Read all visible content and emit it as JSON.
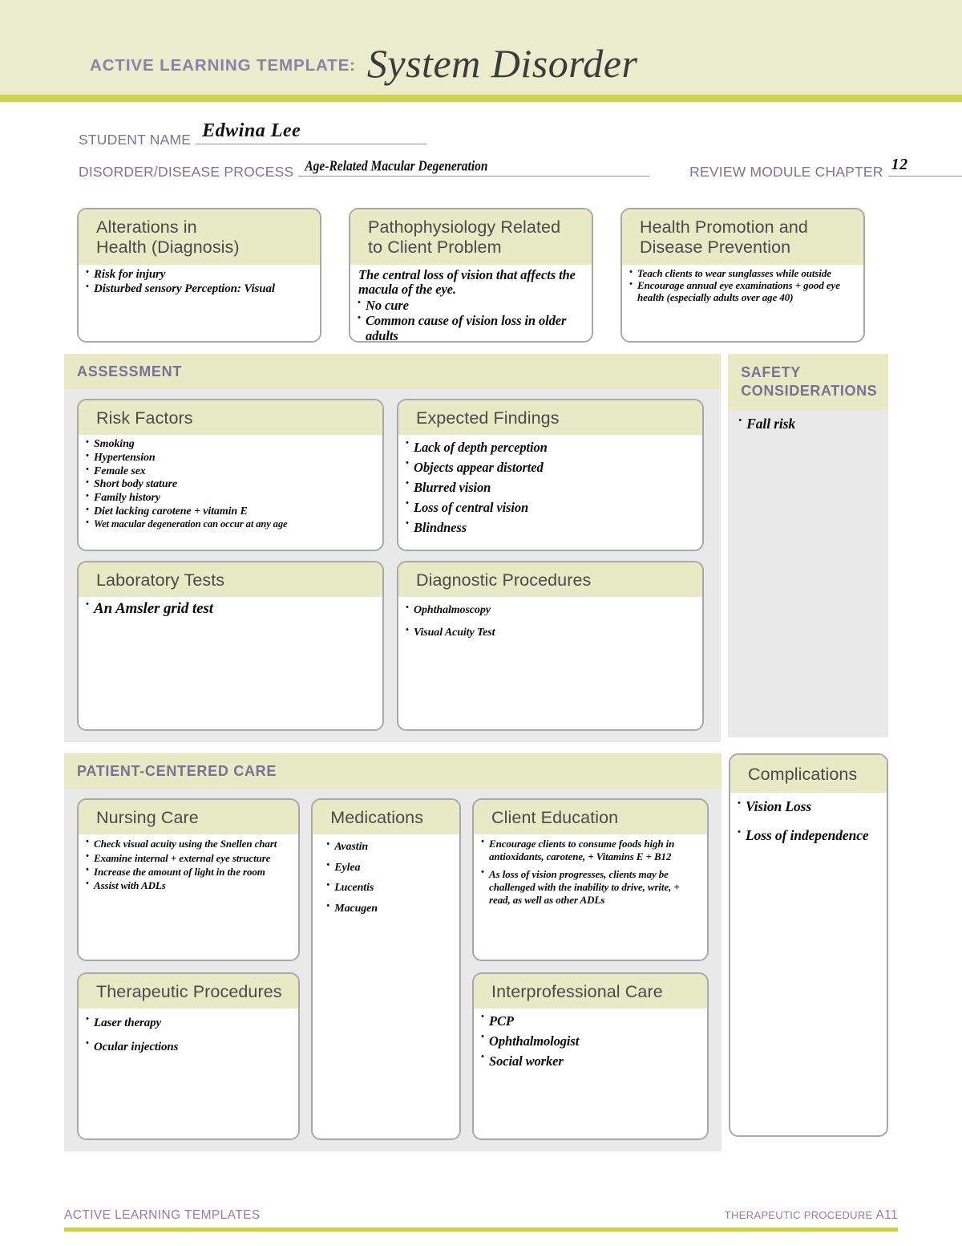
{
  "header": {
    "eyebrow": "ACTIVE LEARNING TEMPLATE:",
    "title": "System Disorder",
    "band_color": "#ebecce",
    "rule_color": "#ccd152"
  },
  "fields": {
    "student_name_label": "STUDENT NAME",
    "student_name_value": "Edwina  Lee",
    "disorder_label": "DISORDER/DISEASE PROCESS",
    "disorder_value": "Age-Related Macular Degeneration",
    "chapter_label": "REVIEW MODULE CHAPTER",
    "chapter_value": "12"
  },
  "top_boxes": [
    {
      "title": "Alterations in\nHealth (Diagnosis)",
      "items": [
        "Risk for injury",
        "Disturbed sensory Perception: Visual"
      ]
    },
    {
      "title": "Pathophysiology Related\nto Client Problem",
      "lead": "The central loss of vision that affects the macula of the eye.",
      "items": [
        "No cure",
        "Common cause of vision loss in older adults"
      ]
    },
    {
      "title": "Health Promotion and\nDisease Prevention",
      "items": [
        "Teach clients to wear sunglasses while outside",
        "Encourage annual eye examinations + good eye health (especially adults over age 40)"
      ]
    }
  ],
  "assessment": {
    "section_title": "ASSESSMENT",
    "risk_factors": {
      "title": "Risk Factors",
      "items": [
        "Smoking",
        "Hypertension",
        "Female sex",
        "Short body stature",
        "Family history",
        "Diet lacking carotene + vitamin E",
        "Wet macular degeneration can occur at any age"
      ]
    },
    "expected_findings": {
      "title": "Expected Findings",
      "items": [
        "Lack of depth perception",
        "Objects appear distorted",
        "Blurred vision",
        "Loss of central vision",
        "Blindness"
      ]
    },
    "laboratory_tests": {
      "title": "Laboratory Tests",
      "items": [
        "An Amsler grid test"
      ]
    },
    "diagnostic_procedures": {
      "title": "Diagnostic Procedures",
      "items": [
        "Ophthalmoscopy",
        "Visual Acuity Test"
      ]
    }
  },
  "safety": {
    "section_title": "SAFETY\nCONSIDERATIONS",
    "items": [
      "Fall risk"
    ]
  },
  "patient_centered_care": {
    "section_title": "PATIENT-CENTERED CARE",
    "nursing_care": {
      "title": "Nursing Care",
      "items": [
        "Check visual acuity using the Snellen chart",
        "Examine internal + external eye structure",
        "Increase the amount of light in the room",
        "Assist with ADLs"
      ]
    },
    "medications": {
      "title": "Medications",
      "items": [
        "Avastin",
        "Eylea",
        "Lucentis",
        "Macugen"
      ]
    },
    "client_education": {
      "title": "Client Education",
      "items": [
        "Encourage clients to consume foods high in antioxidants, carotene, + Vitamins E + B12",
        "As loss of vision progresses, clients may be challenged with the inability to drive, write, + read, as well as other ADLs"
      ]
    },
    "therapeutic_procedures": {
      "title": "Therapeutic Procedures",
      "items": [
        "Laser therapy",
        "Ocular injections"
      ]
    },
    "interprofessional_care": {
      "title": "Interprofessional Care",
      "items": [
        "PCP",
        "Ophthalmologist",
        "Social worker"
      ]
    }
  },
  "complications": {
    "title": "Complications",
    "items": [
      "Vision Loss",
      "Loss of independence"
    ]
  },
  "footer": {
    "left": "ACTIVE LEARNING TEMPLATES",
    "right": "THERAPEUTIC PROCEDURE",
    "page": "A11"
  }
}
